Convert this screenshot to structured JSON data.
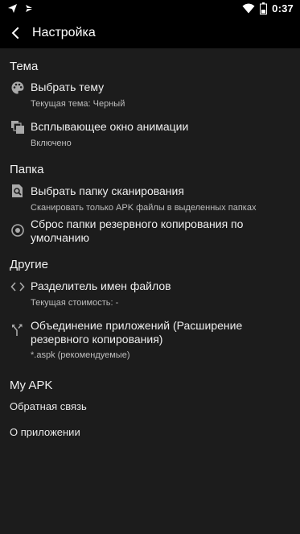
{
  "statusbar": {
    "time": "0:37"
  },
  "appbar": {
    "title": "Настройка"
  },
  "sections": {
    "theme": {
      "title": "Тема",
      "choose_theme": {
        "primary": "Выбрать тему",
        "secondary": "Текущая тема: Черный"
      },
      "animation_popup": {
        "primary": "Всплывающее окно анимации",
        "secondary": "Включено"
      }
    },
    "folder": {
      "title": "Папка",
      "scan_folder": {
        "primary": "Выбрать папку сканирования",
        "secondary": "Сканировать только APK файлы в выделенных папках"
      },
      "reset_backup": {
        "primary": "Сброс папки резервного копирования по умолчанию"
      }
    },
    "other": {
      "title": "Другие",
      "filename_separator": {
        "primary": "Разделитель имен файлов",
        "secondary": "Текущая стоимость: -"
      },
      "merge_apps": {
        "primary": "Объединение приложений (Расширение резервного копирования)",
        "secondary": "*.aspk (рекомендуемые)"
      }
    },
    "myapk": {
      "title": "My APK",
      "feedback": "Обратная связь",
      "about": "О приложении"
    }
  },
  "icons": {
    "statusbar_left": [
      "paper-plane-icon",
      "vpn-key-icon"
    ],
    "statusbar_right": [
      "wifi-icon",
      "battery-icon"
    ],
    "back": "arrow-back-icon",
    "choose_theme": "palette-icon",
    "animation_popup": "layers-icon",
    "scan_folder": "search-document-icon",
    "reset_backup": "radio-target-icon",
    "filename_separator": "code-brackets-icon",
    "merge_apps": "merge-arrows-icon"
  },
  "colors": {
    "background": "#1c1c1c",
    "bars": "#000000",
    "text_primary": "#efefef",
    "text_secondary": "#bdbdbd"
  }
}
